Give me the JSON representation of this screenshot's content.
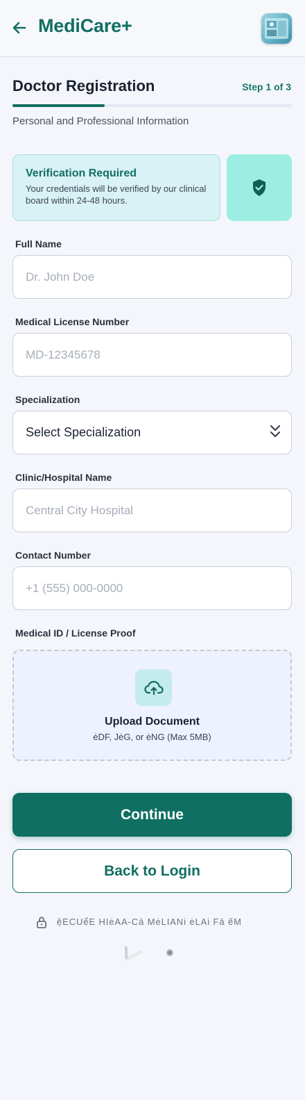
{
  "header": {
    "brand": "MediCare+",
    "back_icon": "arrow-left-icon",
    "avatar": "clinic-avatar"
  },
  "page": {
    "title": "Doctor Registration",
    "step": "Step 1 of 3",
    "progress": 0.33,
    "subtitle": "Personal and Professional Information"
  },
  "verification": {
    "title": "Verification Required",
    "text": "Your credentials will be verified by our clinical board within 24-48 hours.",
    "icon": "shield-check-icon"
  },
  "form": {
    "full_name": {
      "label": "Full Name",
      "placeholder": "Dr. John Doe",
      "value": ""
    },
    "license": {
      "label": "Medical License Number",
      "placeholder": "MD-12345678",
      "value": ""
    },
    "specialization": {
      "label": "Specialization",
      "value": "Select Specialization"
    },
    "clinic": {
      "label": "Clinic/Hospital Name",
      "placeholder": "Central City Hospital",
      "value": ""
    },
    "contact": {
      "label": "Contact Number",
      "placeholder": "+1 (555) 000-0000",
      "value": ""
    },
    "upload": {
      "label": "Medical ID / License Proof",
      "title": "Upload Document",
      "subtitle": "ėDF, JėG, or ėNG (Max 5MB)",
      "icon": "cloud-upload-icon"
    }
  },
  "actions": {
    "continue": "Continue",
    "back_to_login": "Back to Login"
  },
  "footer": {
    "secure_text": "ệECUểE HIėAA-Cā MėLIANi  ėLAi Fā ếM",
    "lock_icon": "lock-icon"
  },
  "colors": {
    "primary": "#0f6f62",
    "accent_text": "#116e61",
    "verify_bg": "#d9f2f5",
    "shield_bg": "#9ceee2",
    "upload_bg": "#eef2fe"
  }
}
